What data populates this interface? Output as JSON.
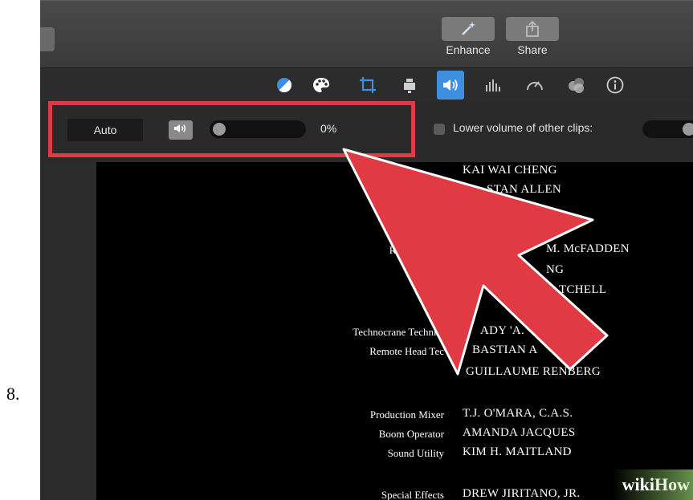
{
  "step_number": "8.",
  "toolbar": {
    "enhance_label": "Enhance",
    "share_label": "Share"
  },
  "inspector_icons": [
    "color-balance-icon",
    "color-palette-icon",
    "crop-icon",
    "stabilization-icon",
    "volume-icon",
    "equalizer-icon",
    "speed-icon",
    "filter-icon",
    "info-icon"
  ],
  "audio_controls": {
    "auto_label": "Auto",
    "volume_percent": "0%",
    "volume_level": 0,
    "lower_volume_label": "Lower volume of other clips:",
    "lower_volume_checked": false
  },
  "credits": [
    {
      "role": "",
      "name": "KAI WAI CHENG"
    },
    {
      "role": "",
      "name": "STAN ALLEN"
    },
    {
      "role": "Key M",
      "name": ""
    },
    {
      "role": "Rigging Best",
      "name": "M. McFADDEN"
    },
    {
      "role": "Riggi",
      "name": "NG"
    },
    {
      "role": "",
      "name": "TCHELL"
    },
    {
      "role": "Technocrane Technici",
      "name": "ADY 'A."
    },
    {
      "role": "Remote Head Tec",
      "name": "BASTIAN      A"
    },
    {
      "role": "",
      "name": "GUILLAUME RENBERG"
    },
    {
      "role": "Production Mixer",
      "name": "T.J. O'MARA, C.A.S."
    },
    {
      "role": "Boom Operator",
      "name": "AMANDA JACQUES"
    },
    {
      "role": "Sound Utility",
      "name": "KIM H. MAITLAND"
    },
    {
      "role": "Special Effects",
      "name": "DREW JIRITANO, JR."
    }
  ],
  "watermark": {
    "wiki": "wiki",
    "how": "How"
  },
  "colors": {
    "highlight": "#e03a45",
    "accent_blue": "#3d8fe0"
  }
}
